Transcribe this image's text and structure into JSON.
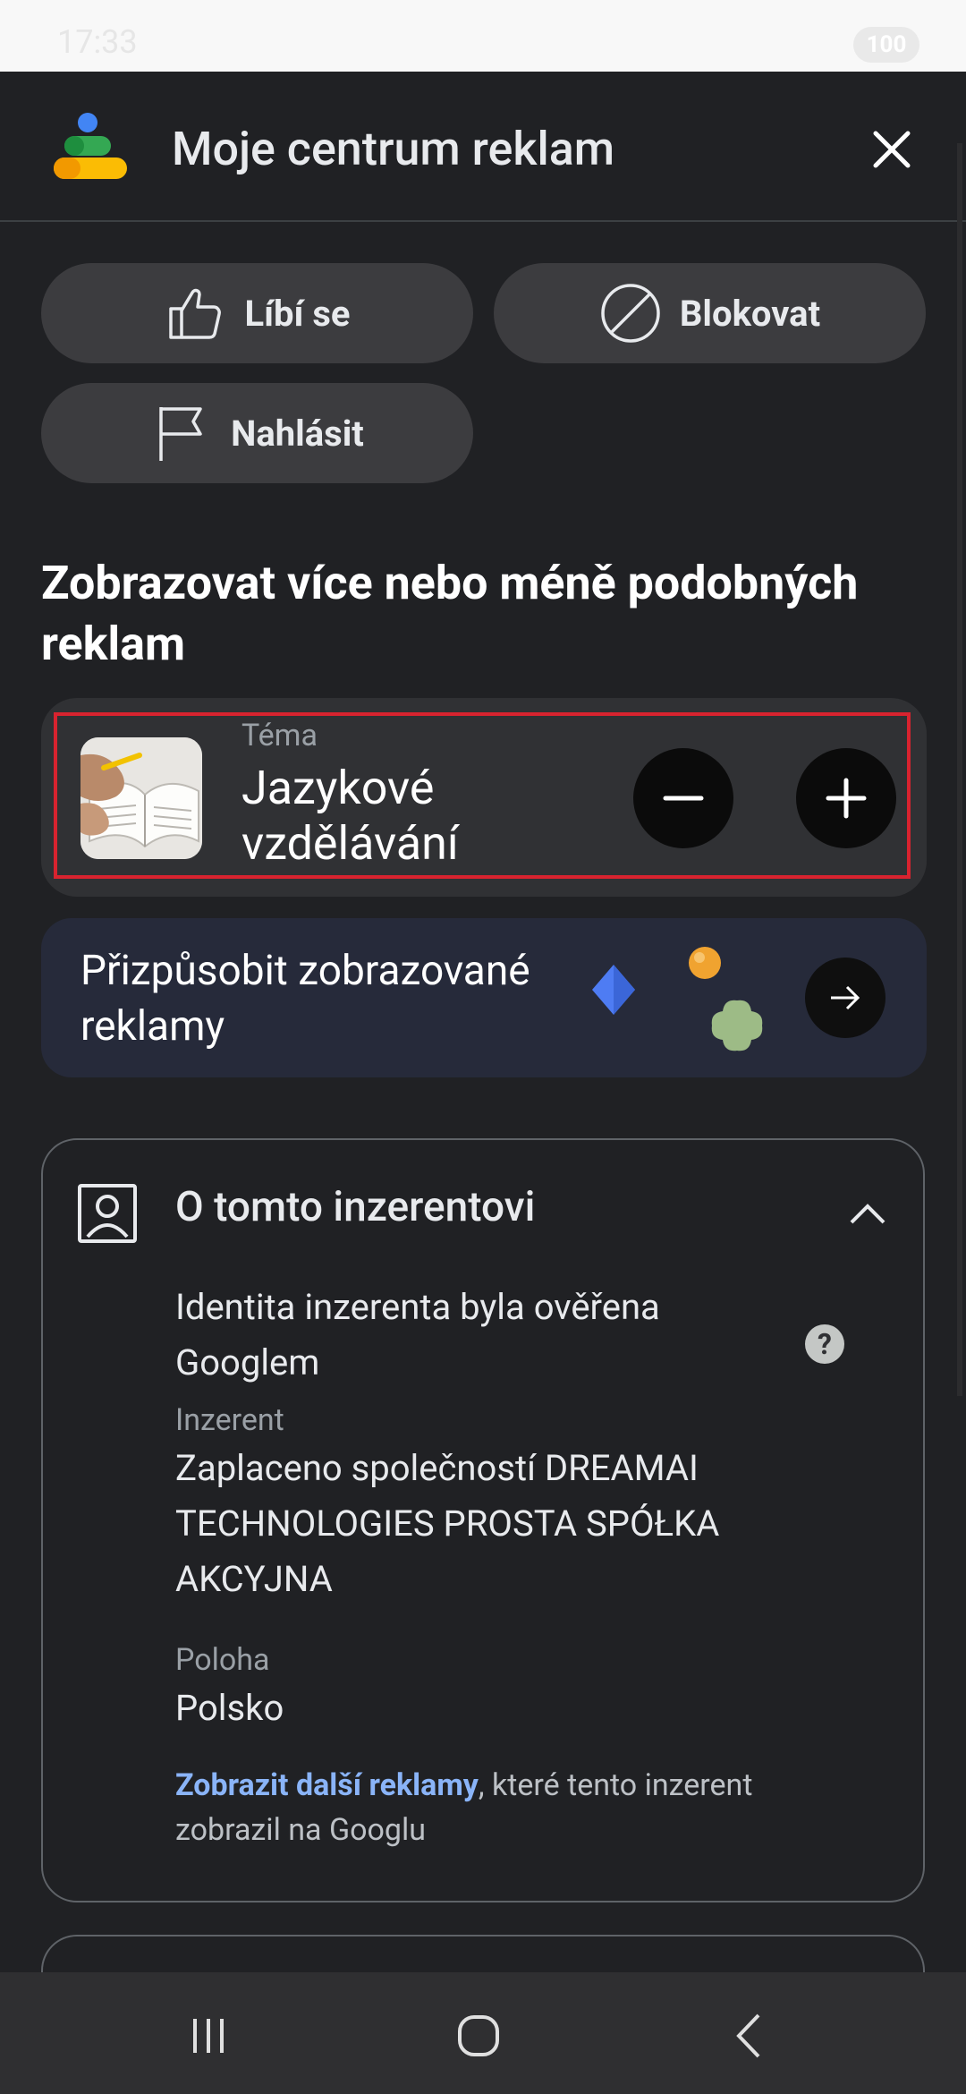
{
  "status_bar": {
    "time": "17:33",
    "battery": "100"
  },
  "header": {
    "title": "Moje centrum reklam",
    "logo_icon": "my-ad-center-logo",
    "close_icon": "close-icon"
  },
  "actions": {
    "like": "Líbí se",
    "block": "Blokovat",
    "report": "Nahlásit"
  },
  "section": {
    "title": "Zobrazovat více nebo méně podobných reklam"
  },
  "topic": {
    "label": "Téma",
    "value": "Jazykové vzdělávání"
  },
  "customize": {
    "text": "Přizpůsobit zobrazované reklamy"
  },
  "advertiser": {
    "title": "O tomto inzerentovi",
    "verified": "Identita inzerenta byla ověřena Googlem",
    "advertiser_label": "Inzerent",
    "advertiser_value": "Zaplaceno společností DREAMAI TECHNOLOGIES PROSTA SPÓŁKA AKCYJNA",
    "location_label": "Poloha",
    "location_value": "Polsko",
    "more_link": "Zobrazit další reklamy",
    "more_suffix": ", které tento inzerent zobrazil na Googlu",
    "help_glyph": "?"
  },
  "colors": {
    "accent_link": "#8ab4f8",
    "highlight_border": "#d8232f",
    "background": "#202124"
  }
}
